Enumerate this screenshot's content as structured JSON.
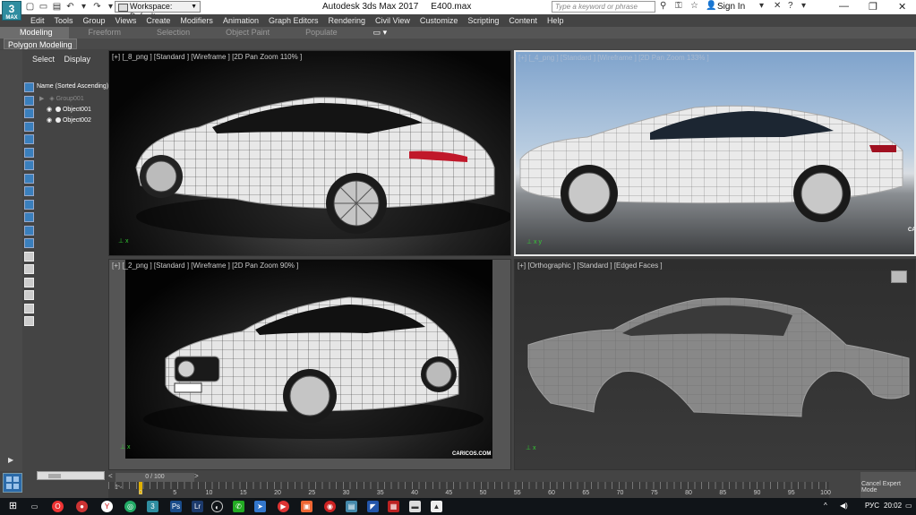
{
  "title_bar": {
    "app_logo": "3",
    "app_logo_sub": "MAX",
    "workspace_label": "Workspace: Default",
    "app_name": "Autodesk 3ds Max 2017",
    "file_name": "E400.max",
    "search_placeholder": "Type a keyword or phrase",
    "sign_in": "Sign In"
  },
  "menu": [
    "Edit",
    "Tools",
    "Group",
    "Views",
    "Create",
    "Modifiers",
    "Animation",
    "Graph Editors",
    "Rendering",
    "Civil View",
    "Customize",
    "Scripting",
    "Content",
    "Help"
  ],
  "ribbon": {
    "tabs": [
      "Modeling",
      "Freeform",
      "Selection",
      "Object Paint",
      "Populate"
    ],
    "active_tab": "Modeling",
    "panel_label": "Polygon Modeling"
  },
  "scene_explorer": {
    "tabs": [
      "Select",
      "Display"
    ],
    "column_header": "Name (Sorted Ascending)",
    "items": [
      {
        "name": "Group001",
        "type": "group"
      },
      {
        "name": "Object001",
        "type": "object"
      },
      {
        "name": "Object002",
        "type": "object"
      }
    ]
  },
  "viewports": [
    {
      "label": "[+] [_8_png ] [Standard ] [Wireframe ] [2D Pan Zoom 110% ]"
    },
    {
      "label": "[+] [_4_png ] [Standard ] [Wireframe ] [2D Pan Zoom 133% ]",
      "watermark": "CA"
    },
    {
      "label": "[+] [_2_png ] [Standard ] [Wireframe ] [2D Pan Zoom 90% ]",
      "watermark": "CARICOS.COM"
    },
    {
      "label": "[+] [Orthographic ] [Standard ] [Edged Faces ]"
    }
  ],
  "timeline": {
    "frame_display": "0 / 100",
    "current_frame": 0,
    "total_frames": 100,
    "tick_labels": [
      "0",
      "5",
      "10",
      "15",
      "20",
      "25",
      "30",
      "35",
      "40",
      "45",
      "50",
      "55",
      "60",
      "65",
      "70",
      "75",
      "80",
      "85",
      "90",
      "95",
      "100"
    ],
    "cancel_expert": "Cancel Expert Mode"
  },
  "taskbar": {
    "language": "РУС",
    "clock": "20:02"
  }
}
